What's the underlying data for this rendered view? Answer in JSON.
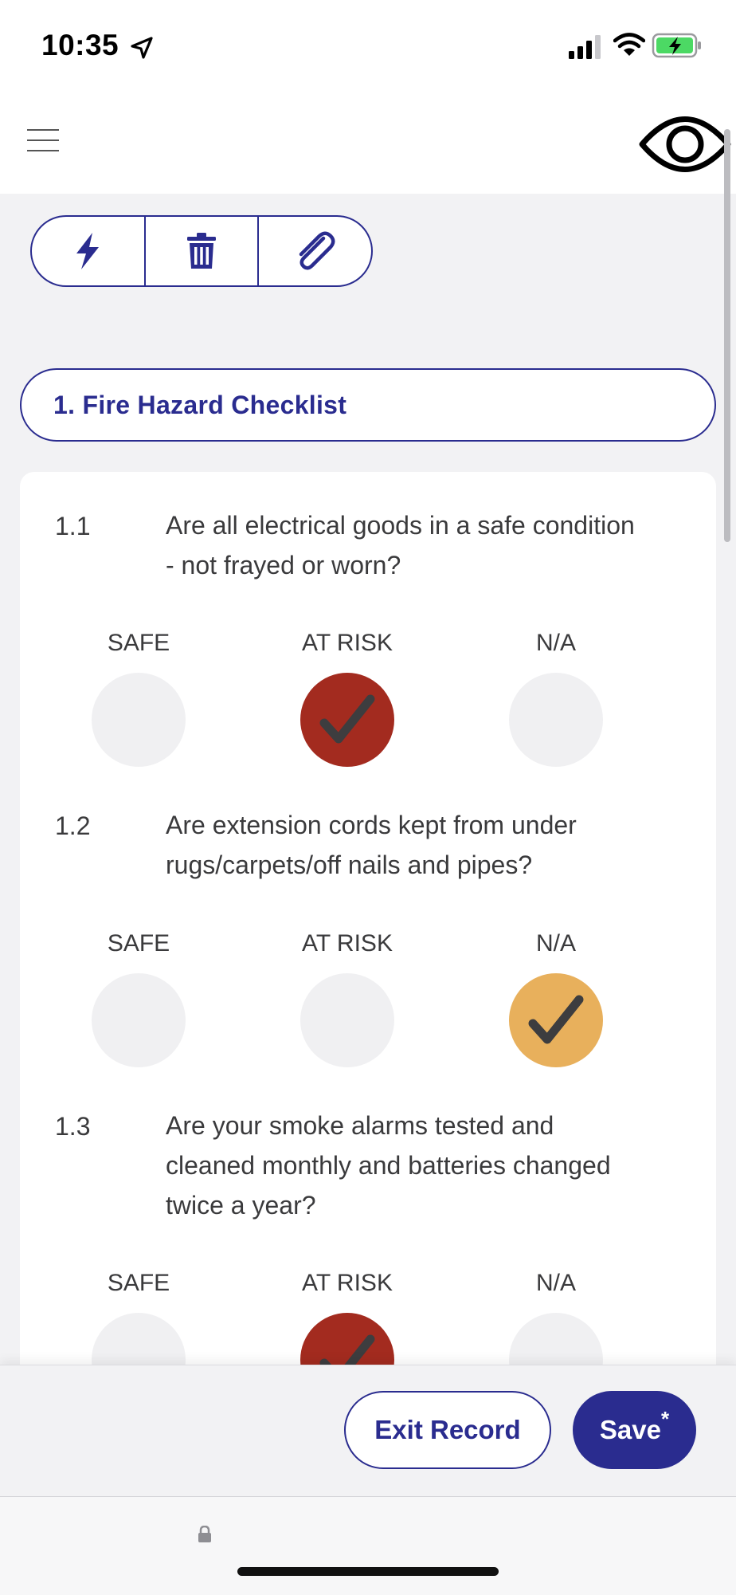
{
  "status_bar": {
    "time": "10:35",
    "icons": [
      "location-arrow-icon",
      "signal-icon",
      "wifi-icon",
      "battery-charging-icon"
    ]
  },
  "nav": {
    "menu_icon": "hamburger-icon",
    "view_icon": "eye-icon"
  },
  "toolbar": {
    "buttons": [
      "lightning-icon",
      "trash-icon",
      "paperclip-icon"
    ]
  },
  "section": {
    "title": "1. Fire Hazard Checklist"
  },
  "questions": [
    {
      "number": "1.1",
      "line1": "Are all electrical goods in a safe condition",
      "line2": "- not frayed or worn?",
      "options": [
        "SAFE",
        "AT RISK",
        "N/A"
      ],
      "selected": "AT RISK"
    },
    {
      "number": "1.2",
      "line1": "Are extension cords kept from under",
      "line2": "rugs/carpets/off nails and pipes?",
      "options": [
        "SAFE",
        "AT RISK",
        "N/A"
      ],
      "selected": "N/A"
    },
    {
      "number": "1.3",
      "line1": "Are your smoke alarms tested and",
      "line2": "cleaned monthly and batteries changed",
      "line3": "twice a year?",
      "options": [
        "SAFE",
        "AT RISK",
        "N/A"
      ],
      "selected": "AT RISK"
    }
  ],
  "footer": {
    "exit_label": "Exit Record",
    "save_label": "Save",
    "save_marker": "*"
  },
  "colors": {
    "brand": "#2a2c8f",
    "at_risk": "#a32b1f",
    "na": "#e8b05c",
    "unselected": "#f0f0f2"
  }
}
